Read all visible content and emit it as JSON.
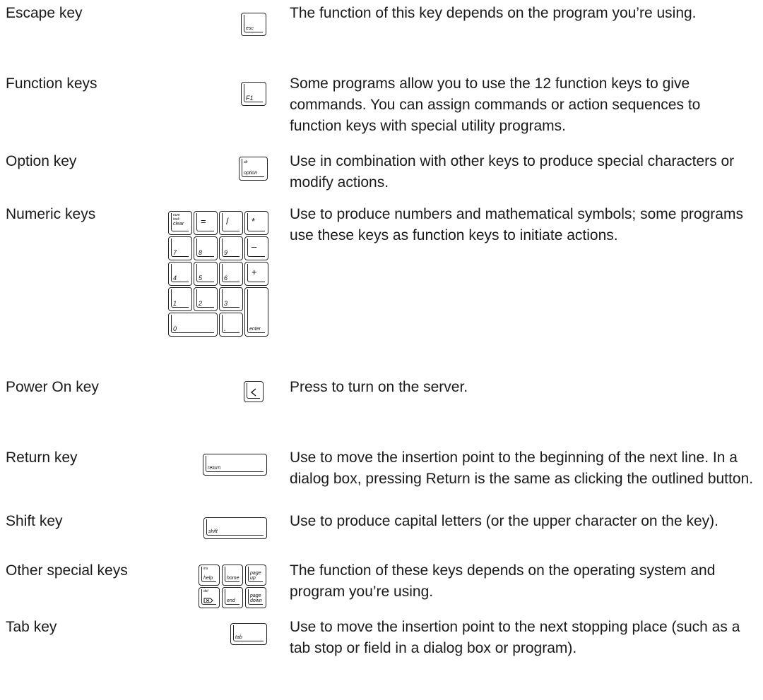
{
  "entries": [
    {
      "term": "Escape key",
      "description": "The function of this key depends on the program you’re using.",
      "keys": [
        "esc"
      ]
    },
    {
      "term": "Function keys",
      "description": "Some programs allow you to use the 12 function keys to give commands. You can assign commands or action sequences to function keys with special utility programs.",
      "keys": [
        "F1"
      ]
    },
    {
      "term": "Option key",
      "description": "Use in combination with other keys to produce special characters or modify actions.",
      "keys": [
        "alt",
        "option"
      ]
    },
    {
      "term": "Numeric keys",
      "description": "Use to produce numbers and mathematical symbols; some programs use these keys as function keys to initiate actions.",
      "keys": [
        "num",
        "lock",
        "clear",
        "=",
        "/",
        "*",
        "7",
        "8",
        "9",
        "–",
        "4",
        "5",
        "6",
        "+",
        "1",
        "2",
        "3",
        "0",
        ".",
        "enter"
      ]
    },
    {
      "term": "Power On key",
      "description": "Press to turn on the server.",
      "keys": []
    },
    {
      "term": "Return key",
      "description": "Use to move the insertion point to the beginning of the next line. In a dialog box, pressing Return is the same as clicking the outlined button.",
      "keys": [
        "return"
      ]
    },
    {
      "term": "Shift key",
      "description": "Use to produce capital letters (or the upper character on the key).",
      "keys": [
        "shift"
      ]
    },
    {
      "term": "Other special keys",
      "description": "The function of these keys depends on the operating system and program you’re using.",
      "keys": [
        "ins",
        "help",
        "home",
        "page",
        "up",
        "del",
        "end",
        "page",
        "down"
      ]
    },
    {
      "term": "Tab key",
      "description": "Use to move the insertion point to the next stopping place (such as a tab stop or field in a dialog box or program).",
      "keys": [
        "tab"
      ]
    }
  ]
}
